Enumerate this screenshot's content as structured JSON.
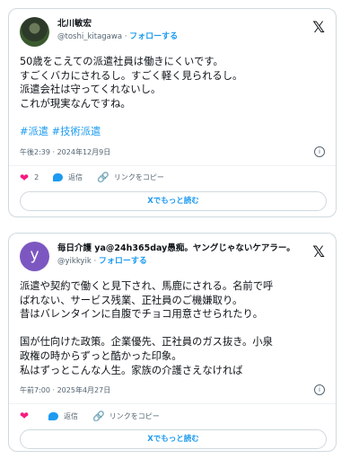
{
  "tweets": [
    {
      "name": "北川敏宏",
      "handle": "@toshi_kitagawa",
      "dot": "·",
      "follow": "フォローする",
      "lines": [
        "50歳をこえての派遣社員は働きにくいです。",
        "すごくバカにされるし。すごく軽く見られるし。",
        "派遣会社は守ってくれないし。",
        "これが現実なんですね。"
      ],
      "hashtags": "#派遣 #技術派遣",
      "time": "午後2:39 · 2024年12月9日",
      "likes": "2",
      "reply": "返信",
      "copy_link": "リンクをコピー",
      "read_more": "Xでもっと読む"
    },
    {
      "name": "毎日介護 ya@24h365day愚痴。ヤングじゃないケアラー。",
      "handle": "@yikkyik",
      "dot": "·",
      "follow": "フォローする",
      "avatar_letter": "y",
      "lines": [
        "派遣や契約で働くと見下され、馬鹿にされる。名前で呼",
        "ばれない、サービス残業、正社員のご機嫌取り。",
        "昔はバレンタインに自腹でチョコ用意させられたり。"
      ],
      "lines2": [
        "国が仕向けた政策。企業優先、正社員のガス抜き。小泉",
        "政権の時からずっと酷かった印象。",
        "私はずっとこんな人生。家族の介護さえなければ"
      ],
      "time": "午前7:00 · 2025年4月27日",
      "reply": "返信",
      "copy_link": "リンクをコピー",
      "read_more": "Xでもっと読む"
    }
  ],
  "icons": {
    "x_logo": "𝕏",
    "heart": "❤",
    "info": "i",
    "link": "🔗"
  }
}
